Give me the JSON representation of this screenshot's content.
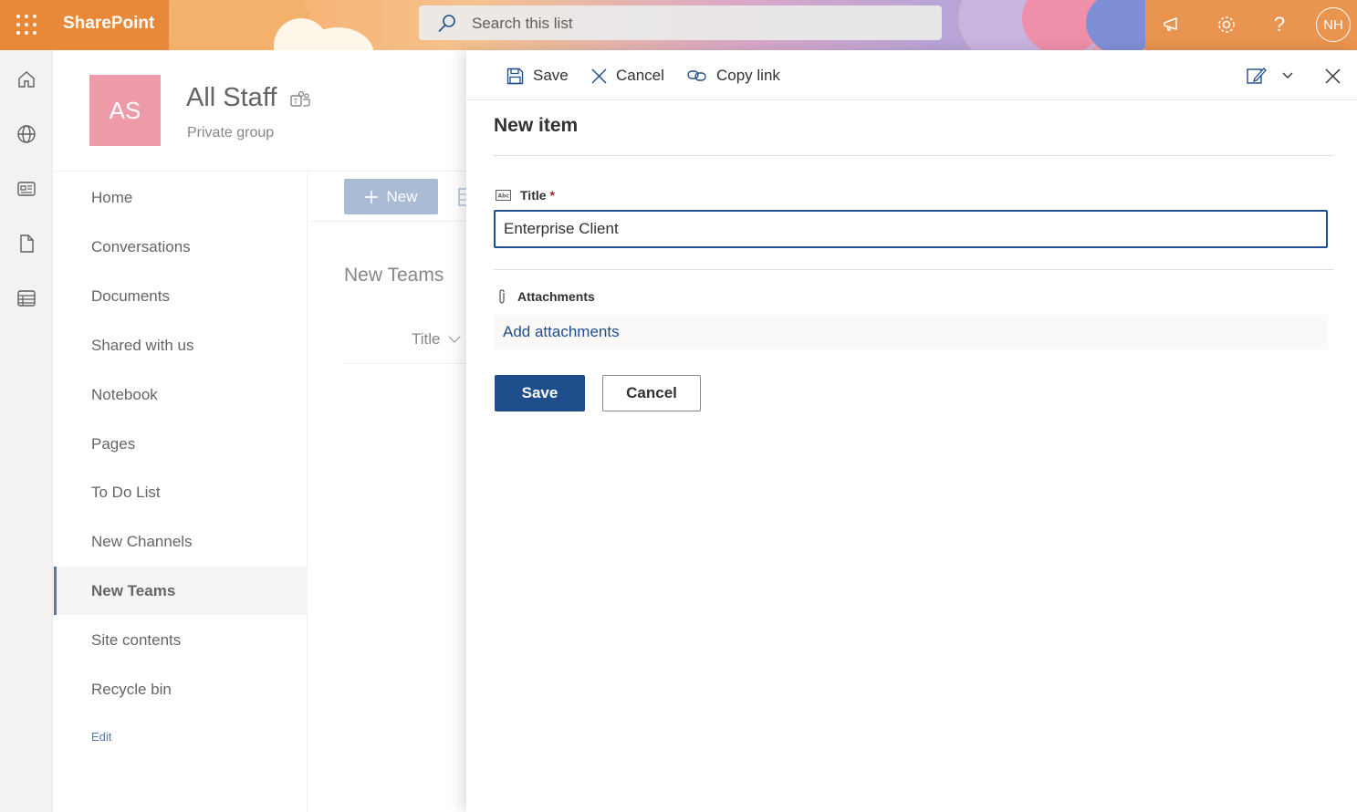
{
  "suite": {
    "app_name": "SharePoint",
    "search_placeholder": "Search this list",
    "user_initials": "NH",
    "icons": [
      "waffle-icon",
      "megaphone-icon",
      "gear-icon",
      "help-icon"
    ]
  },
  "rail": {
    "icons": [
      "home-icon",
      "globe-icon",
      "news-icon",
      "file-icon",
      "list-icon"
    ]
  },
  "site": {
    "logo_initials": "AS",
    "title": "All Staff",
    "subtitle": "Private group"
  },
  "nav": {
    "items": [
      {
        "label": "Home"
      },
      {
        "label": "Conversations"
      },
      {
        "label": "Documents"
      },
      {
        "label": "Shared with us"
      },
      {
        "label": "Notebook"
      },
      {
        "label": "Pages"
      },
      {
        "label": "To Do List"
      },
      {
        "label": "New Channels"
      },
      {
        "label": "New Teams",
        "active": true
      },
      {
        "label": "Site contents"
      },
      {
        "label": "Recycle bin"
      }
    ],
    "edit_label": "Edit"
  },
  "main": {
    "new_button": "New",
    "list_title": "New Teams",
    "column_title": "Title"
  },
  "panel": {
    "commands": {
      "save": "Save",
      "cancel": "Cancel",
      "copy_link": "Copy link"
    },
    "heading": "New item",
    "title_field": {
      "label": "Title",
      "required_marker": "*",
      "value": "Enterprise Client"
    },
    "attachments": {
      "label": "Attachments",
      "add_link": "Add attachments"
    },
    "buttons": {
      "save": "Save",
      "cancel": "Cancel"
    }
  },
  "colors": {
    "accent": "#1f4e8c",
    "site_logo": "#e97a8c",
    "suite_orange": "#e8893a"
  }
}
